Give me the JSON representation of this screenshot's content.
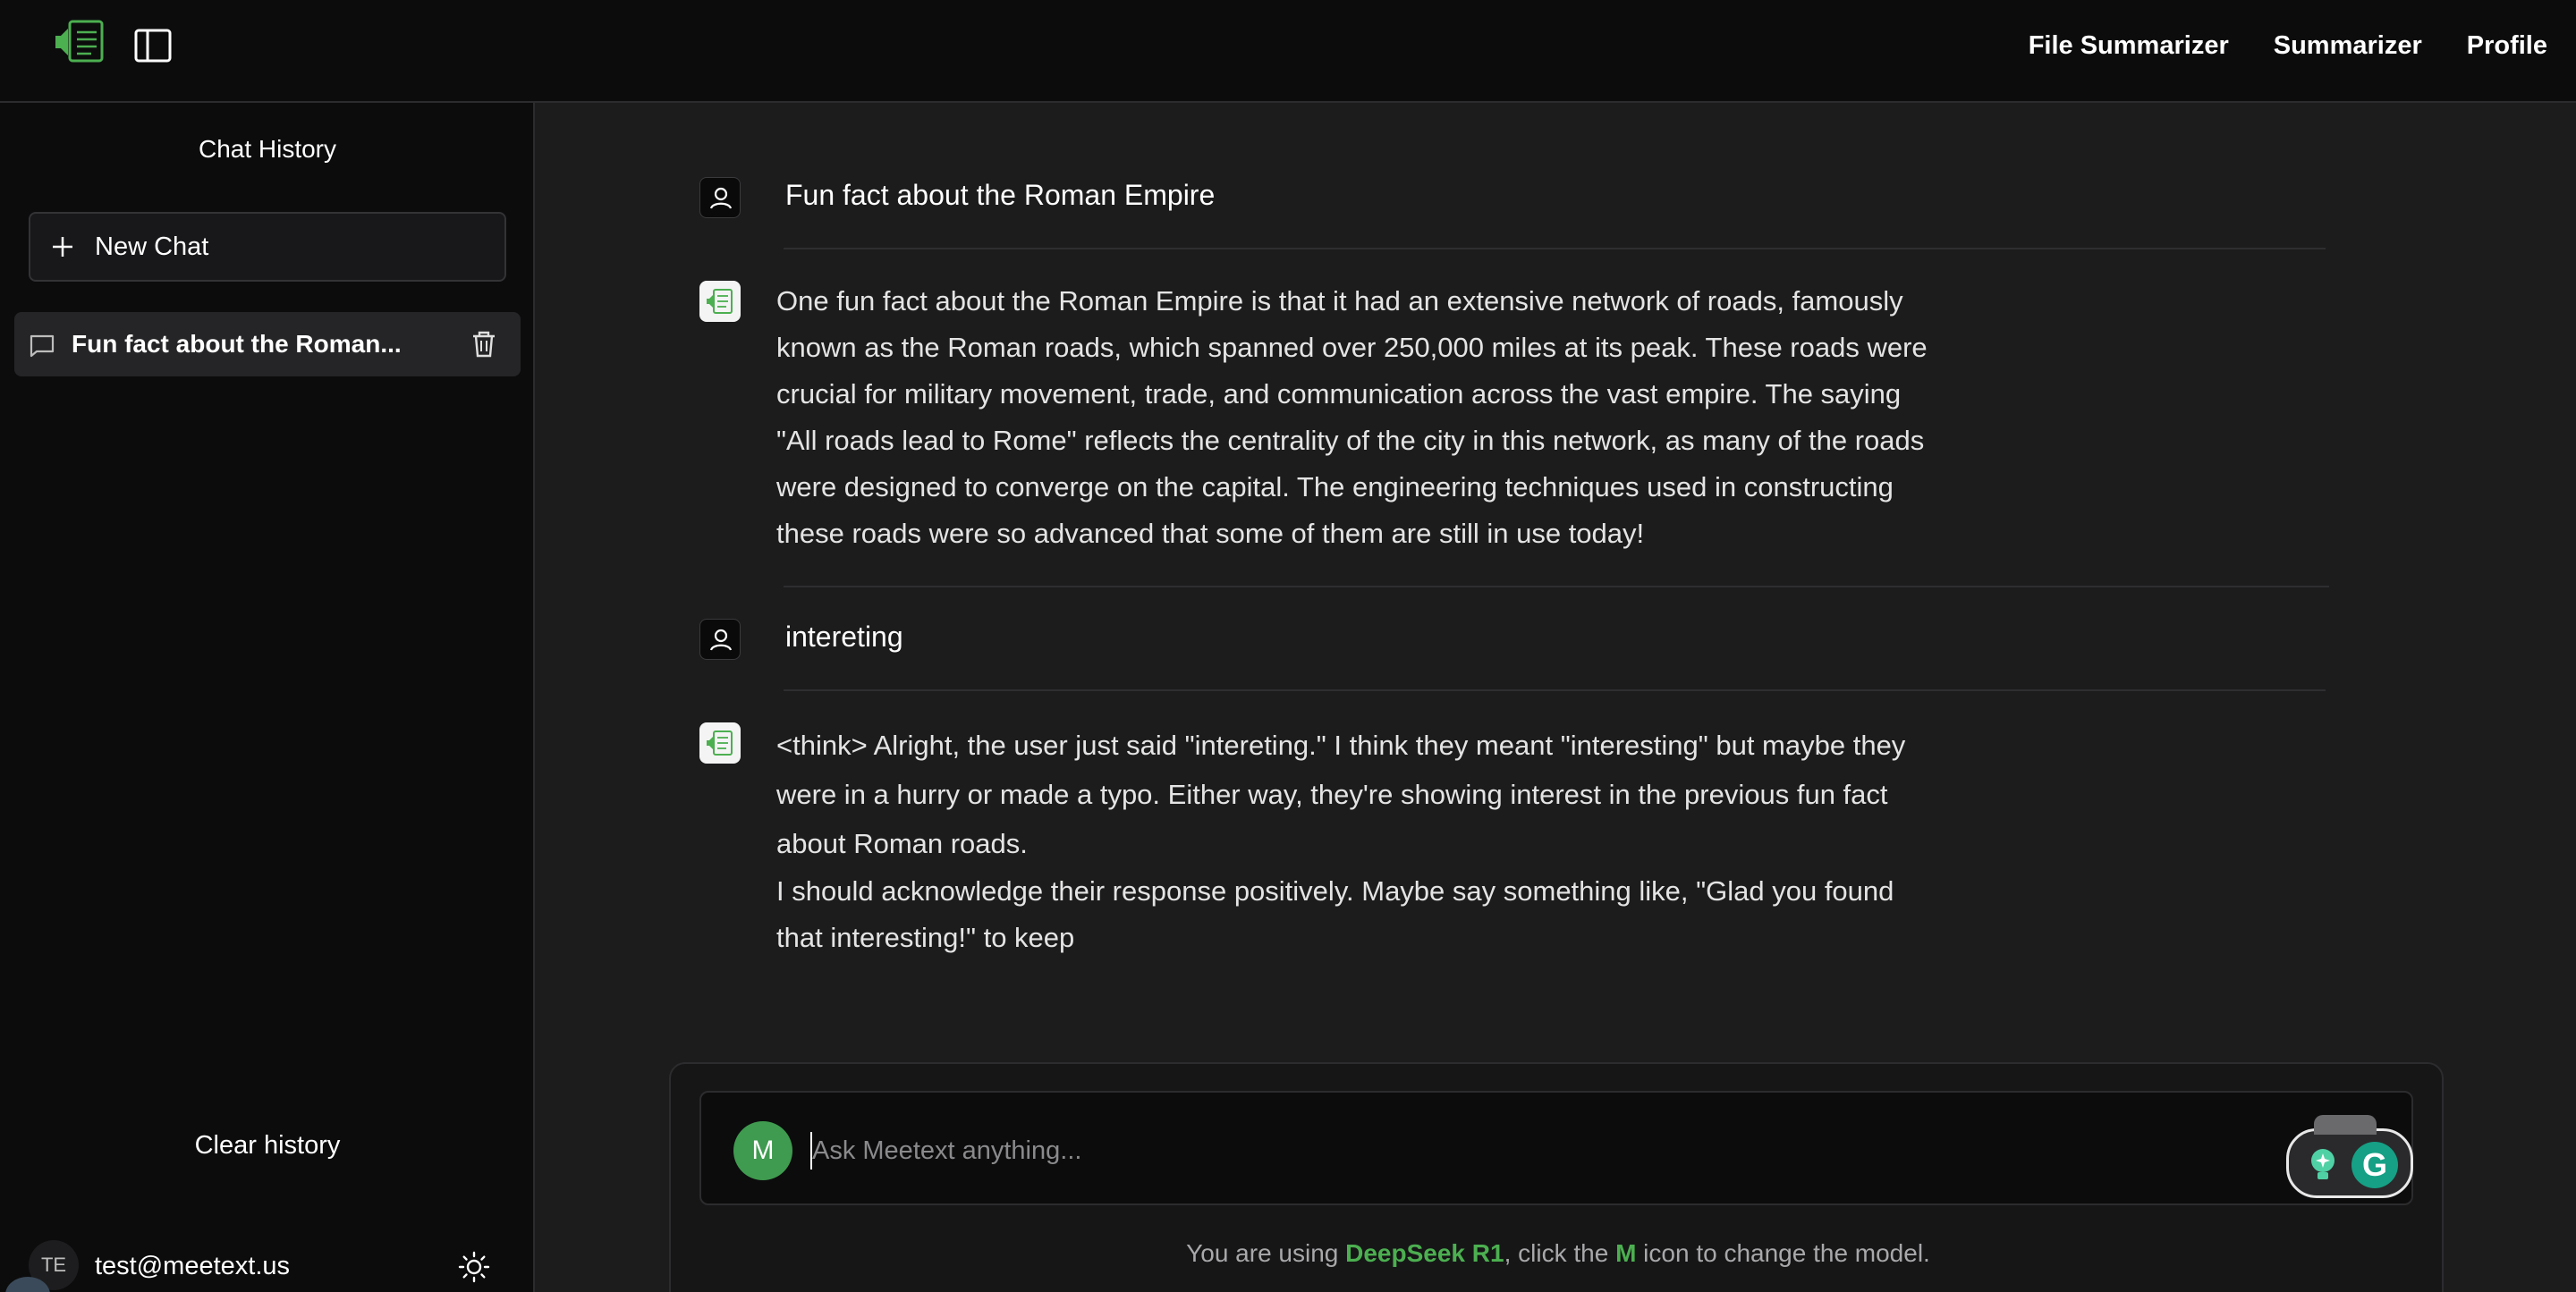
{
  "nav": {
    "file_summarizer": "File Summarizer",
    "summarizer": "Summarizer",
    "profile": "Profile"
  },
  "sidebar": {
    "title": "Chat History",
    "new_chat": "New Chat",
    "history": [
      {
        "label": "Fun fact about the Roman..."
      }
    ],
    "clear_history": "Clear history",
    "user_initials": "TE",
    "user_email": "test@meetext.us"
  },
  "messages": [
    {
      "role": "user",
      "text": "Fun fact about the Roman Empire"
    },
    {
      "role": "assistant",
      "lines": [
        "One fun fact about the Roman Empire is that it had an extensive network of roads, famously",
        "known as the Roman roads, which spanned over 250,000 miles at its peak. These roads were",
        "crucial for military movement, trade, and communication across the vast empire. The saying",
        "\"All roads lead to Rome\" reflects the centrality of the city in this network, as many of the roads",
        "were designed to converge on the capital. The engineering techniques used in constructing",
        "these roads were so advanced that some of them are still in use today!"
      ]
    },
    {
      "role": "user",
      "text": "intereting"
    },
    {
      "role": "assistant",
      "lines": [
        "<think> Alright, the user just said \"intereting.\" I think they meant \"interesting\" but maybe they",
        "were in a hurry or made a typo. Either way, they're showing interest in the previous fun fact",
        "about Roman roads.",
        "I should acknowledge their response positively. Maybe say something like, \"Glad you found",
        "that interesting!\" to keep"
      ]
    }
  ],
  "input": {
    "model_initial": "M",
    "placeholder": "Ask Meetext anything...",
    "grammarly_letter": "G"
  },
  "model_hint": {
    "prefix": "You are using ",
    "model_name": "DeepSeek R1",
    "middle": ", click the ",
    "icon_letter": "M",
    "suffix": " icon to change the model."
  },
  "icons": {
    "logo": "meetext-logo-icon",
    "sidebar_toggle": "sidebar-panel-icon",
    "new_chat": "plus-icon",
    "chat": "chat-bubble-icon",
    "delete": "trash-icon",
    "theme": "sun-icon",
    "user": "user-icon",
    "bot": "meetext-bot-icon"
  },
  "colors": {
    "accent_green": "#4caf50",
    "model_button": "#3f9b4f",
    "background": "#1c1c1d",
    "sidebar": "#0c0c0d"
  }
}
